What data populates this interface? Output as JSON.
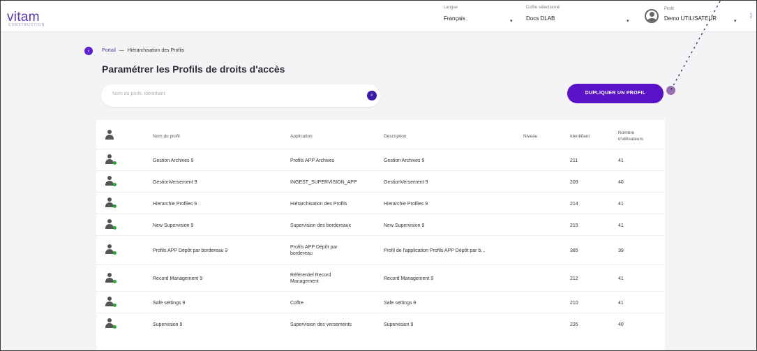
{
  "header": {
    "logo": "vitam",
    "logo_sub": "CONSTRUCTION",
    "language_label": "Langue",
    "language_value": "Français",
    "vault_label": "Coffre sélectionné",
    "vault_value": "Docs DLAB",
    "profile_label": "Profil",
    "profile_value": "Demo UTILISATEUR",
    "caret": "▾",
    "menu_icon": "⁞"
  },
  "breadcrumb": {
    "portal": "Portail",
    "separator": "—",
    "current": "Hiérarchisation des Profils"
  },
  "page_title": "Paramétrer les Profils de droits d'accès",
  "search": {
    "placeholder": "Nom du profil, identifiant",
    "icon": "⌕"
  },
  "actions": {
    "duplicate": "DUPLIQUER UN PROFIL"
  },
  "table": {
    "columns": {
      "name": "Nom du profil",
      "application": "Application",
      "description": "Description",
      "level": "Niveau",
      "identifier": "Identifiant",
      "users": "Nombre d'utilisateurs"
    },
    "rows": [
      {
        "name": "Gestion Archives 9",
        "application": "Profils APP Archives",
        "description": "Gestion Archives 9",
        "id": "211",
        "users": "41"
      },
      {
        "name": "GestionVersement 9",
        "application": "INGEST_SUPERVISION_APP",
        "description": "GestionVersement 9",
        "id": "209",
        "users": "40"
      },
      {
        "name": "Hierarchie Profiles 9",
        "application": "Hiérarchisation des Profils",
        "description": "Hierarchie Profiles 9",
        "id": "214",
        "users": "41"
      },
      {
        "name": "New Supervision 9",
        "application": "Supervision des bordereaux",
        "description": "New Supervision 9",
        "id": "215",
        "users": "41"
      },
      {
        "name": "Profils APP Dépôt par bordereau 9",
        "application": "Profils APP Dépôt par bordereau",
        "description": "Profil de l'application Profils APP Dépôt par b...",
        "id": "385",
        "users": "39"
      },
      {
        "name": "Record Management 9",
        "application": "Référentiel Record Management",
        "description": "Record Management 9",
        "id": "212",
        "users": "41"
      },
      {
        "name": "Safe settings 9",
        "application": "Coffre",
        "description": "Safe settings 9",
        "id": "210",
        "users": "41"
      },
      {
        "name": "Supervision 9",
        "application": "Supervision des versements",
        "description": "Supervision 9",
        "id": "235",
        "users": "40"
      }
    ]
  }
}
